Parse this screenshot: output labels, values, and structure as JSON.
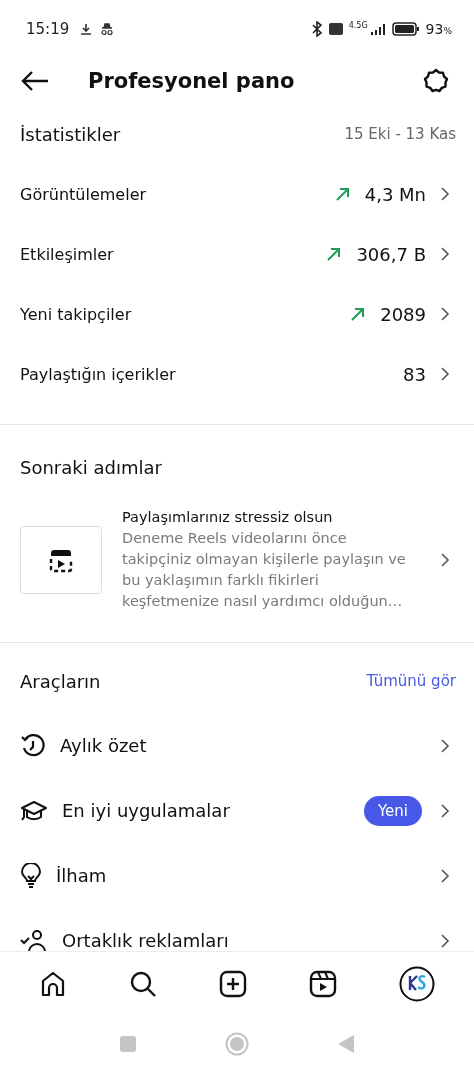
{
  "status_bar": {
    "time": "15:19",
    "network": "4.5G",
    "battery": "93",
    "battery_unit": "%"
  },
  "header": {
    "title": "Profesyonel pano"
  },
  "statistics": {
    "title": "İstatistikler",
    "date_range": "15 Eki - 13 Kas",
    "rows": [
      {
        "label": "Görüntülemeler",
        "value": "4,3 Mn",
        "rising": true
      },
      {
        "label": "Etkileşimler",
        "value": "306,7 B",
        "rising": true
      },
      {
        "label": "Yeni takipçiler",
        "value": "2089",
        "rising": true
      },
      {
        "label": "Paylaştığın içerikler",
        "value": "83",
        "rising": false
      }
    ]
  },
  "next_steps": {
    "title": "Sonraki adımlar",
    "card": {
      "title": "Paylaşımlarınız stressiz olsun",
      "description": "Deneme Reels videolarını önce takipçiniz olmayan kişilerle paylaşın ve bu yaklaşımın farklı fikirleri keşfetmenize nasıl yardımcı olduğun…"
    }
  },
  "tools": {
    "title": "Araçların",
    "see_all": "Tümünü gör",
    "items": [
      {
        "label": "Aylık özet",
        "kind": "history"
      },
      {
        "label": "En iyi uygulamalar",
        "kind": "cap",
        "badge": "Yeni"
      },
      {
        "label": "İlham",
        "kind": "bulb"
      },
      {
        "label": "Ortaklık reklamları",
        "kind": "person"
      }
    ]
  },
  "bottom_nav": [
    {
      "kind": "home"
    },
    {
      "kind": "search"
    },
    {
      "kind": "add"
    },
    {
      "kind": "reels"
    },
    {
      "kind": "profile"
    }
  ]
}
